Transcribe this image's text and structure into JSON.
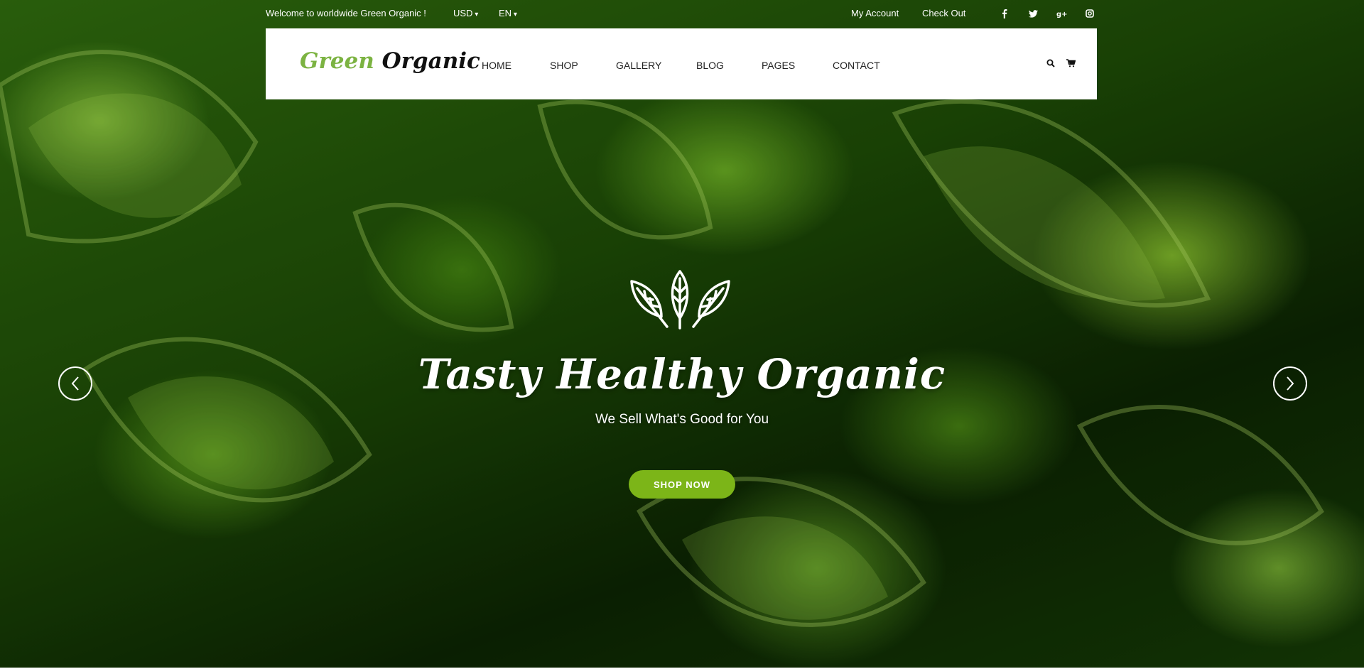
{
  "topbar": {
    "welcome": "Welcome to worldwide Green Organic !",
    "currency": "USD",
    "language": "EN",
    "my_account": "My Account",
    "check_out": "Check Out",
    "social": [
      "facebook-icon",
      "twitter-icon",
      "google-plus-icon",
      "instagram-icon"
    ]
  },
  "header": {
    "logo_green": "Green",
    "logo_organic": "Organic",
    "nav": [
      "HOME",
      "SHOP",
      "GALLERY",
      "BLOG",
      "PAGES",
      "CONTACT"
    ],
    "icons": [
      "search-icon",
      "cart-icon"
    ]
  },
  "hero": {
    "title": "Tasty Healthy Organic",
    "subtitle": "We Sell What's Good for You",
    "button": "SHOP NOW"
  },
  "colors": {
    "accent": "#7cb518",
    "logo_green": "#7cb342",
    "nav_text": "#222222",
    "white": "#ffffff"
  }
}
